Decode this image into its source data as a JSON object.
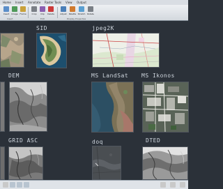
{
  "titlebar": {
    "tabs": [
      "Home",
      "Insert",
      "Annotate",
      "Raster Tools",
      "View",
      "Output"
    ]
  },
  "ribbon": {
    "buttons": [
      {
        "label": "Insert",
        "icon": "image-insert-icon",
        "color": "#5b8ec9"
      },
      {
        "label": "Image",
        "icon": "image-icon",
        "color": "#4f9a5a"
      },
      {
        "label": "Frame",
        "icon": "frame-icon",
        "color": "#c9a13b"
      },
      {
        "label": "Crop",
        "icon": "crop-icon",
        "color": "#7a7f86"
      },
      {
        "label": "Clip",
        "icon": "clip-icon",
        "color": "#8b5fb0"
      },
      {
        "label": "Delete",
        "icon": "delete-icon",
        "color": "#cc3a3a"
      },
      {
        "label": "Adjust",
        "icon": "adjust-icon",
        "color": "#4a7fb8"
      },
      {
        "label": "Palette",
        "icon": "palette-icon",
        "color": "#d07a2e"
      },
      {
        "label": "Stretch",
        "icon": "stretch-icon",
        "color": "#5a9fd1"
      },
      {
        "label": "Rotate",
        "icon": "rotate-icon",
        "color": "#7a7f86"
      }
    ],
    "groups": [
      "Insert",
      "Edit",
      "Display Properties"
    ]
  },
  "datasets": [
    {
      "label": "",
      "kind": "image-tile-1"
    },
    {
      "label": "SID",
      "kind": "image-tile-2"
    },
    {
      "label": "jpeg2K",
      "kind": "image-tile-3"
    },
    {
      "label": "DEM",
      "kind": "image-tile-4"
    },
    {
      "label": "MS LandSat",
      "kind": "image-tile-5"
    },
    {
      "label": "MS Ikonos",
      "kind": "image-tile-6"
    },
    {
      "label": "GRID ASC",
      "kind": "image-tile-7"
    },
    {
      "label": "doq",
      "kind": "image-tile-8"
    },
    {
      "label": "DTED",
      "kind": "image-tile-9"
    }
  ],
  "colors": {
    "canvas": "#2b3139",
    "label": "#cfd6de"
  }
}
